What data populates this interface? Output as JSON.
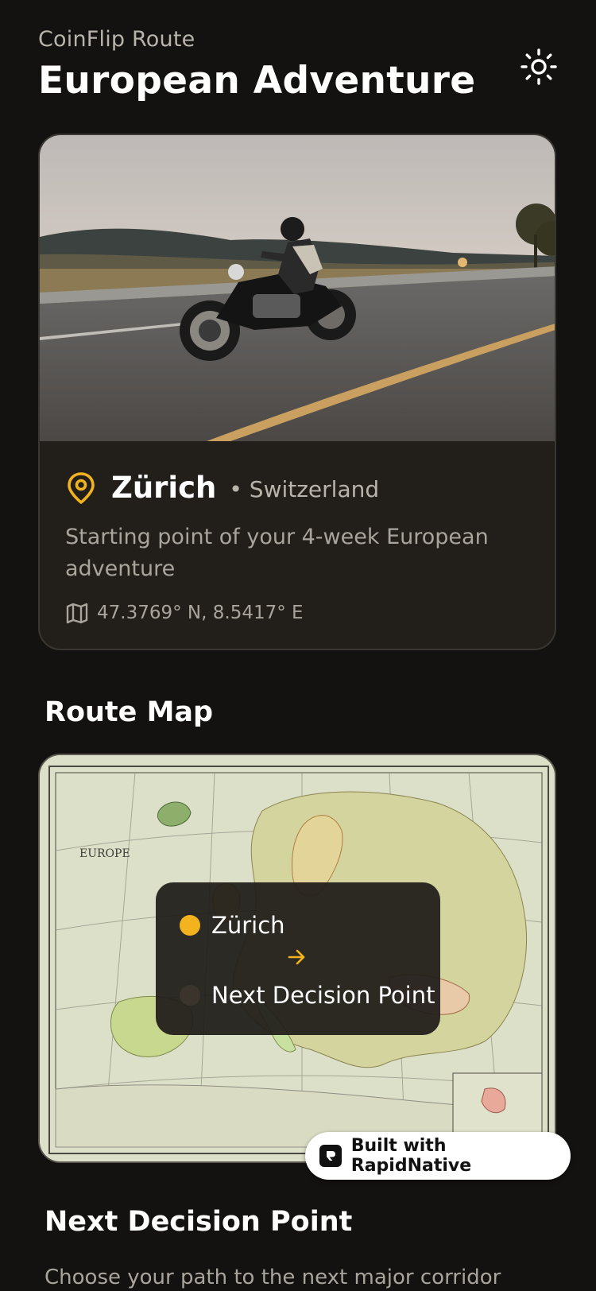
{
  "header": {
    "subtitle": "CoinFlip Route",
    "title": "European Adventure",
    "theme_icon": "sun-icon"
  },
  "location": {
    "city": "Zürich",
    "country": "• Switzerland",
    "description": "Starting point of your 4-week European adventure",
    "coordinates": "47.3769° N, 8.5417° E",
    "pin_icon": "map-pin-icon",
    "coords_icon": "map-icon"
  },
  "route_map": {
    "title": "Route Map",
    "map_label": "EUROPE",
    "from": "Zürich",
    "to": "Next Decision Point",
    "colors": {
      "from_dot": "#f2b31e",
      "to_dot": "#3b342c",
      "arrow": "#f2b31e"
    }
  },
  "badge": {
    "label": "Built with RapidNative"
  },
  "next_decision": {
    "title": "Next Decision Point",
    "description": "Choose your path to the next major corridor"
  },
  "colors": {
    "background": "#141210",
    "card": "#221f1b",
    "accent": "#f2b31e"
  }
}
